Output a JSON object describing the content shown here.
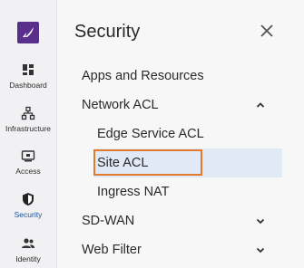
{
  "rail": {
    "items": [
      {
        "label": "Dashboard",
        "icon": "dashboard-icon"
      },
      {
        "label": "Infrastructure",
        "icon": "infrastructure-icon"
      },
      {
        "label": "Access",
        "icon": "access-icon"
      },
      {
        "label": "Security",
        "icon": "shield-icon"
      },
      {
        "label": "Identity",
        "icon": "identity-icon"
      }
    ],
    "active": "Security"
  },
  "panel": {
    "title": "Security",
    "close_icon": "close-icon",
    "items": [
      {
        "label": "Apps and Resources"
      },
      {
        "label": "Network ACL",
        "state": "expanded"
      },
      {
        "label": "Edge Service ACL"
      },
      {
        "label": "Site ACL",
        "selected": true
      },
      {
        "label": "Ingress NAT"
      },
      {
        "label": "SD-WAN",
        "state": "collapsed"
      },
      {
        "label": "Web Filter",
        "state": "collapsed"
      }
    ]
  },
  "colors": {
    "logo": "#5a2f8c",
    "active_rail": "#1a4f9c",
    "selection_bg": "#e0e9f5",
    "focus_outline": "#e07a2d"
  }
}
